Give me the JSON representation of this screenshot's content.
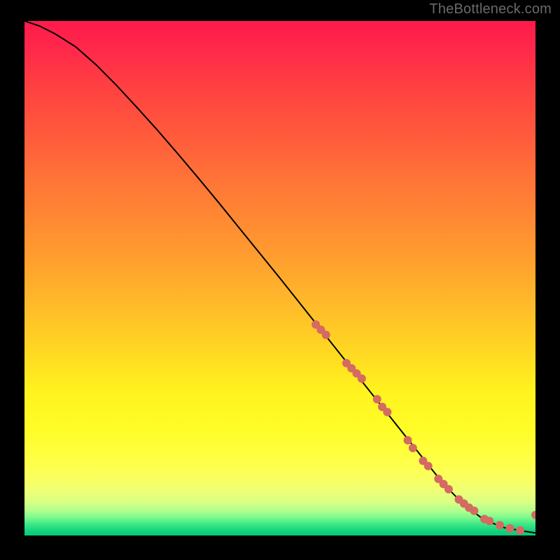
{
  "watermark": "TheBottleneck.com",
  "chart_data": {
    "type": "line",
    "title": "",
    "xlabel": "",
    "ylabel": "",
    "xlim": [
      0,
      100
    ],
    "ylim": [
      0,
      100
    ],
    "grid": false,
    "legend": false,
    "series": [
      {
        "name": "curve",
        "style": "line",
        "color": "#000000",
        "x": [
          0,
          3,
          6,
          10,
          14,
          18,
          22,
          26,
          30,
          34,
          38,
          42,
          46,
          50,
          54,
          58,
          62,
          66,
          70,
          74,
          78,
          82,
          86,
          90,
          94,
          98,
          100
        ],
        "values": [
          100,
          99,
          97.5,
          95,
          91.5,
          87.5,
          83.2,
          78.8,
          74.2,
          69.5,
          64.7,
          59.8,
          54.9,
          50,
          45,
          40,
          35,
          30,
          25,
          20,
          15,
          10,
          6,
          3,
          1.5,
          0.8,
          0.5
        ]
      },
      {
        "name": "markers",
        "style": "scatter",
        "color": "#d46a62",
        "x": [
          57,
          58,
          59,
          63,
          64,
          65,
          66,
          69,
          70,
          71,
          75,
          76,
          78,
          79,
          81,
          82,
          83,
          85,
          86,
          87,
          88,
          90,
          91,
          93,
          95,
          97,
          100
        ],
        "values": [
          41,
          40,
          39,
          33.5,
          32.5,
          31.5,
          30.5,
          26.5,
          25,
          24,
          18.5,
          17,
          14.5,
          13.5,
          11,
          10,
          9,
          7,
          6.2,
          5.4,
          4.8,
          3.2,
          2.8,
          2.0,
          1.4,
          1.0,
          4.0
        ]
      }
    ]
  }
}
